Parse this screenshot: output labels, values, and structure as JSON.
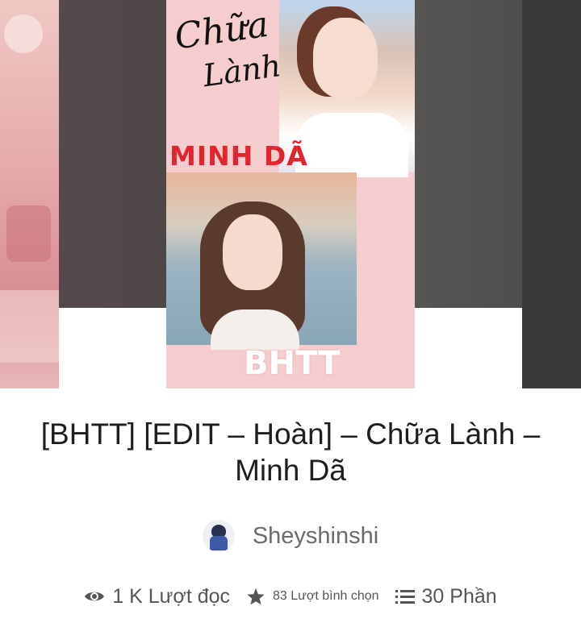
{
  "cover": {
    "script_title_line1": "Chữa",
    "script_title_line2": "Lành",
    "author_text": "MINH DÃ",
    "tag_text": "BHTT"
  },
  "story": {
    "title": "[BHTT] [EDIT – Hoàn] – Chữa Lành – Minh Dã"
  },
  "author": {
    "name": "Sheyshinshi"
  },
  "stats": {
    "reads": "1 K Lượt đọc",
    "votes": "83 Lượt bình chọn",
    "parts": "30 Phần"
  },
  "icons": {
    "reads": "eye-icon",
    "votes": "star-icon",
    "parts": "list-icon"
  },
  "colors": {
    "cover_author": "#e0252f",
    "cover_bg": "#f6cdcf",
    "text_dark": "#1e1e1e",
    "text_muted": "#555555"
  }
}
